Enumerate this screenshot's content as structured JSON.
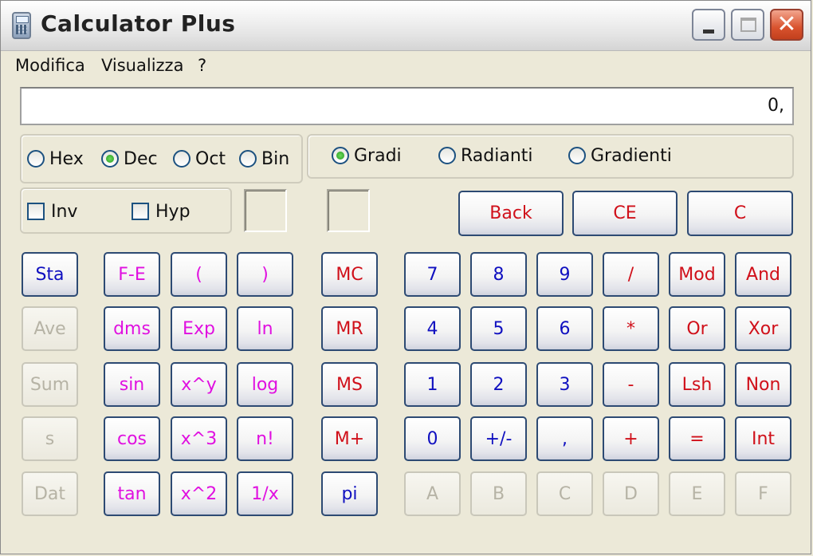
{
  "window": {
    "title": "Calculator Plus"
  },
  "menu": [
    "Modifica",
    "Visualizza",
    "?"
  ],
  "display": {
    "value": "0,"
  },
  "number_system": [
    {
      "label": "Hex",
      "selected": false
    },
    {
      "label": "Dec",
      "selected": true
    },
    {
      "label": "Oct",
      "selected": false
    },
    {
      "label": "Bin",
      "selected": false
    }
  ],
  "angle_mode": [
    {
      "label": "Gradi",
      "selected": true
    },
    {
      "label": "Radianti",
      "selected": false
    },
    {
      "label": "Gradienti",
      "selected": false
    }
  ],
  "checks": [
    {
      "label": "Inv",
      "checked": false
    },
    {
      "label": "Hyp",
      "checked": false
    }
  ],
  "edit_buttons": [
    "Back",
    "CE",
    "C"
  ],
  "stat_buttons": [
    "Sta",
    "Ave",
    "Sum",
    "s",
    "Dat"
  ],
  "func_buttons": [
    [
      "F-E",
      "(",
      ")"
    ],
    [
      "dms",
      "Exp",
      "ln"
    ],
    [
      "sin",
      "x^y",
      "log"
    ],
    [
      "cos",
      "x^3",
      "n!"
    ],
    [
      "tan",
      "x^2",
      "1/x"
    ]
  ],
  "mem_buttons": [
    "MC",
    "MR",
    "MS",
    "M+",
    "pi"
  ],
  "main_buttons": [
    [
      "7",
      "8",
      "9",
      "/",
      "Mod",
      "And"
    ],
    [
      "4",
      "5",
      "6",
      "*",
      "Or",
      "Xor"
    ],
    [
      "1",
      "2",
      "3",
      "-",
      "Lsh",
      "Non"
    ],
    [
      "0",
      "+/-",
      ",",
      "+",
      "=",
      "Int"
    ],
    [
      "A",
      "B",
      "C",
      "D",
      "E",
      "F"
    ]
  ],
  "colors": {
    "digit": "#1010c0",
    "operator": "#d0101a",
    "function": "#e010e0",
    "disabled": "#b6b3a5"
  }
}
